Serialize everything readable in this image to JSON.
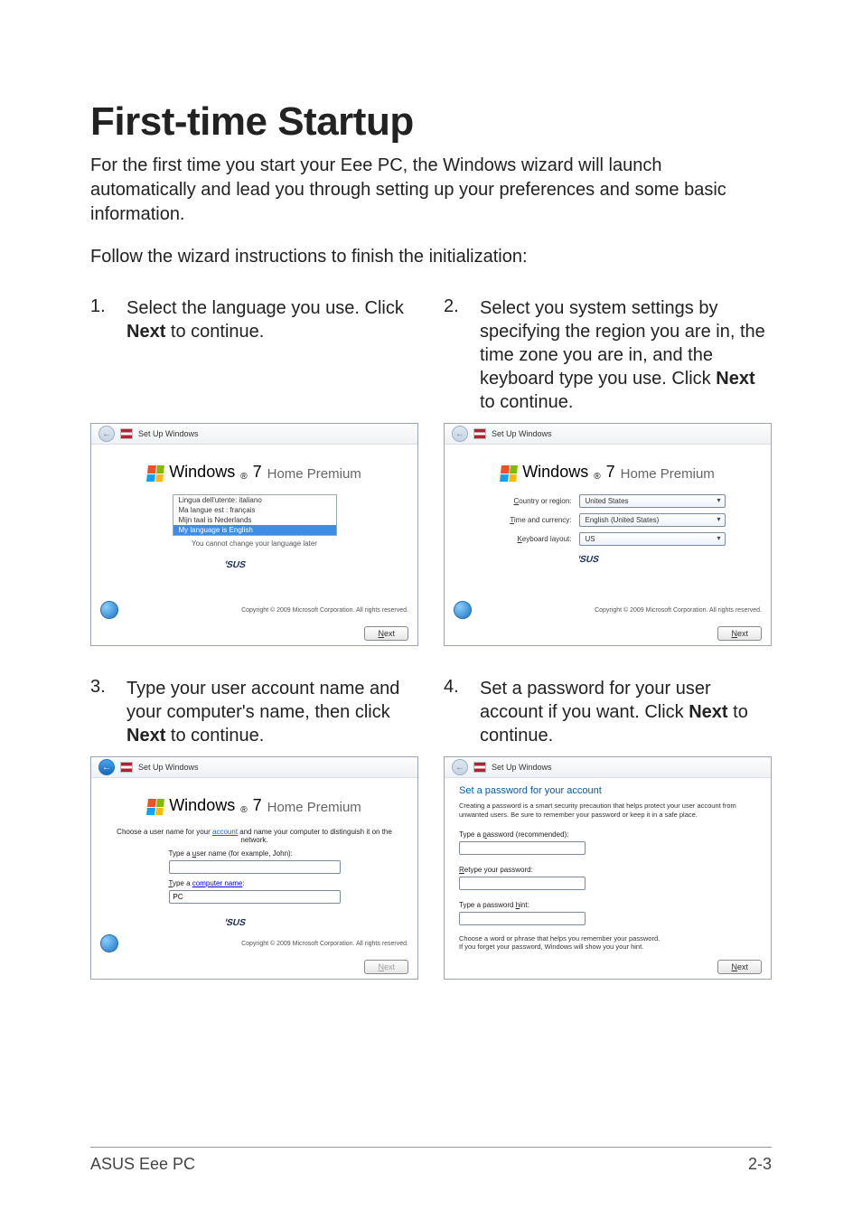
{
  "page": {
    "title": "First-time Startup",
    "intro": "For the first time you start your Eee PC, the Windows wizard will launch automatically and lead you through setting up your preferences and some basic information.",
    "follow": "Follow the wizard instructions to finish the initialization:",
    "footer_left": "ASUS Eee PC",
    "footer_right": "2-3"
  },
  "steps": {
    "s1": {
      "num": "1.",
      "text_a": "Select the language you use. Click ",
      "bold": "Next",
      "text_b": " to continue."
    },
    "s2": {
      "num": "2.",
      "text_a": "Select you system settings by specifying the region you are in, the time zone you are in, and the keyboard type you use. Click ",
      "bold": "Next",
      "text_b": " to continue."
    },
    "s3": {
      "num": "3.",
      "text_a": "Type your user account name and your computer's name, then click ",
      "bold": "Next",
      "text_b": " to continue."
    },
    "s4": {
      "num": "4.",
      "text_a": "Set a password for your user account if you want. Click ",
      "bold": "Next",
      "text_b": " to continue."
    }
  },
  "win": {
    "titlebar": "Set Up Windows",
    "brand_a": "Windows",
    "brand_seven": "7",
    "brand_edition": "Home Premium",
    "asus": "ASUS",
    "copyright": "Copyright © 2009 Microsoft Corporation.  All rights reserved.",
    "next_n": "N",
    "next_ext": "ext"
  },
  "shot1": {
    "lang0": "Lingua dell'utente: italiano",
    "lang1": "Ma langue est : français",
    "lang2": "Mijn taal is Nederlands",
    "lang3": "My language is English",
    "note": "You cannot change your language later"
  },
  "shot2": {
    "l_region_c": "C",
    "l_region_rest": "ountry or region:",
    "l_time_t": "T",
    "l_time_rest": "ime and currency:",
    "l_kb_k": "K",
    "l_kb_rest": "eyboard layout:",
    "v_region": "United States",
    "v_time": "English (United States)",
    "v_kb": "US"
  },
  "shot3": {
    "note_a": "Choose a user name for your ",
    "note_link": "account",
    "note_b": " and name your computer to distinguish it on the network.",
    "lbl_user_a": "Type a ",
    "lbl_user_u": "u",
    "lbl_user_b": "ser name (for example, John):",
    "lbl_comp_t": "T",
    "lbl_comp_a": "ype a ",
    "lbl_comp_link": "computer name",
    "lbl_comp_b": ":",
    "val_comp": "PC"
  },
  "shot4": {
    "head": "Set a password for your account",
    "note": "Creating a password is a smart security precaution that helps protect your user account from unwanted users. Be sure to remember your password or keep it in a safe place.",
    "lbl_pw_a": "Type a ",
    "lbl_pw_p": "p",
    "lbl_pw_b": "assword (recommended):",
    "lbl_re_r": "R",
    "lbl_re_b": "etype your password:",
    "lbl_hint_a": "Type a password ",
    "lbl_hint_h": "h",
    "lbl_hint_b": "int:",
    "hintnote": "Choose a word or phrase that helps you remember your password.\nIf you forget your password, Windows will show you your hint."
  }
}
